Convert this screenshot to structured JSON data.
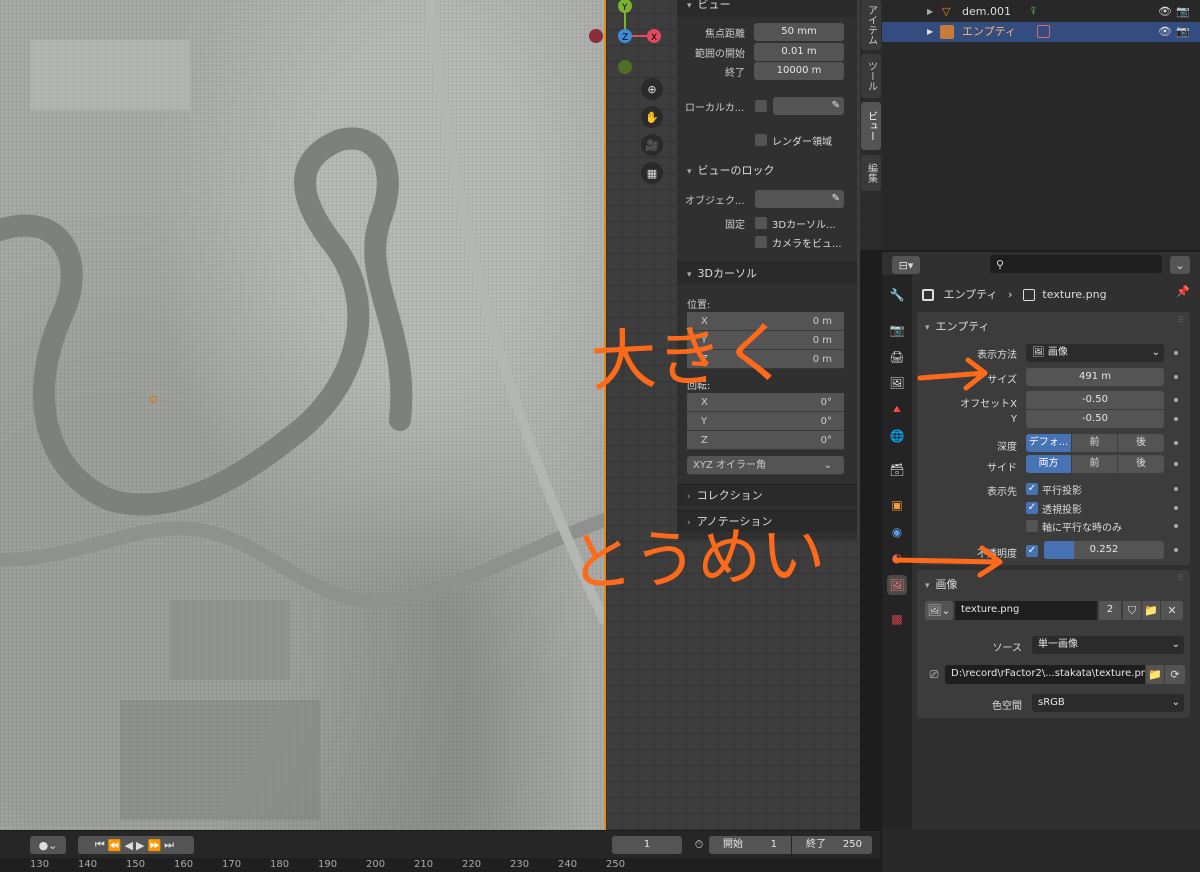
{
  "outliner": {
    "items": [
      {
        "name": "dem.001",
        "icon": "mesh-icon",
        "selected": false
      },
      {
        "name": "エンプティ",
        "icon": "empty-icon",
        "selected": true
      }
    ]
  },
  "side_tabs": [
    "アイテム",
    "ツール",
    "ビュー",
    "編集"
  ],
  "view_panel": {
    "focal_label": "焦点距離",
    "focal_value": "50 mm",
    "clip_start_label": "範囲の開始",
    "clip_start_value": "0.01 m",
    "clip_end_label": "終了",
    "clip_end_value": "10000 m",
    "local_camera_label": "ローカルカ...",
    "render_region_label": "レンダー領域",
    "lock_header": "ビューのロック",
    "lock_object_label": "オブジェク...",
    "lock_label": "固定",
    "lock_cursor_label": "3Dカーソル...",
    "lock_camera_label": "カメラをビュ..."
  },
  "cursor_panel": {
    "header": "3Dカーソル",
    "location_label": "位置:",
    "loc": [
      {
        "axis": "X",
        "value": "0 m"
      },
      {
        "axis": "Y",
        "value": "0 m"
      },
      {
        "axis": "Z",
        "value": "0 m"
      }
    ],
    "rotation_label": "回転:",
    "rot": [
      {
        "axis": "X",
        "value": "0°"
      },
      {
        "axis": "Y",
        "value": "0°"
      },
      {
        "axis": "Z",
        "value": "0°"
      }
    ],
    "mode": "XYZ オイラー角"
  },
  "collection_header": "コレクション",
  "annotation_header": "アノテーション",
  "properties": {
    "breadcrumb_object": "エンプティ",
    "breadcrumb_texture": "texture.png",
    "empty_header": "エンプティ",
    "display_label": "表示方法",
    "display_value": "画像",
    "size_label": "サイズ",
    "size_value": "491 m",
    "offset_x_label": "オフセットX",
    "offset_x_value": "-0.50",
    "offset_y_label": "Y",
    "offset_y_value": "-0.50",
    "depth_label": "深度",
    "depth_options": [
      "デフォ...",
      "前",
      "後"
    ],
    "side_label": "サイド",
    "side_options": [
      "両方",
      "前",
      "後"
    ],
    "show_label": "表示先",
    "show_ortho": "平行投影",
    "show_persp": "透視投影",
    "show_axis": "軸に平行な時のみ",
    "opacity_label": "不透明度",
    "opacity_value": "0.252",
    "opacity_fraction": 0.252,
    "image_header": "画像",
    "image_name": "texture.png",
    "image_users": "2",
    "source_label": "ソース",
    "source_value": "単一画像",
    "filepath": "D:\\record\\rFactor2\\...stakata\\texture.png",
    "colorspace_label": "色空間",
    "colorspace_value": "sRGB"
  },
  "timeline": {
    "current_frame": "1",
    "start_label": "開始",
    "start_value": "1",
    "end_label": "終了",
    "end_value": "250"
  },
  "ruler": [
    "130",
    "140",
    "150",
    "160",
    "170",
    "180",
    "190",
    "200",
    "210",
    "220",
    "230",
    "240",
    "250"
  ],
  "annotations": {
    "big": "大きく",
    "transparent": "とうめい"
  },
  "colors": {
    "accent": "#4772b3",
    "annotation": "#ff6a1a",
    "gizmo_x": "#e34a5e",
    "gizmo_y": "#7ab32e",
    "gizmo_z": "#3d8bd9"
  }
}
